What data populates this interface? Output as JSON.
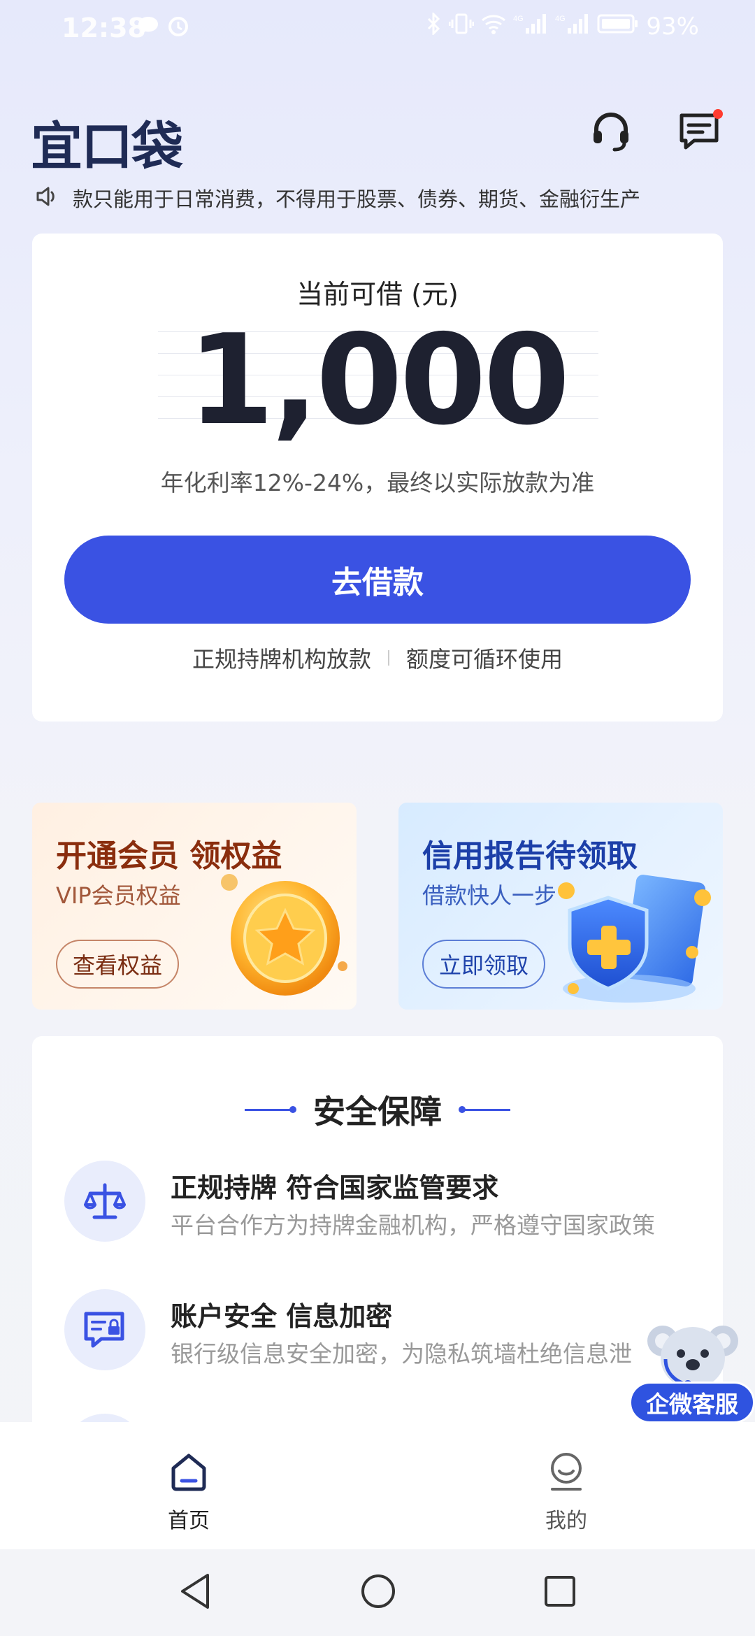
{
  "status_bar": {
    "time": "12:38",
    "battery": "93%",
    "network1": "4G",
    "network2": "4G"
  },
  "header": {
    "logo": "宜口袋",
    "icons": [
      "headset-icon",
      "message-icon"
    ]
  },
  "notice": {
    "icon": "speaker-icon",
    "text": "款只能用于日常消费，不得用于股票、债券、期货、金融衍生产"
  },
  "main_card": {
    "amount_label": "当前可借 (元)",
    "amount": "1,000",
    "rate_text": "年化利率12%-24%，最终以实际放款为准",
    "borrow_button": "去借款",
    "feature_left": "正规持牌机构放款",
    "feature_right": "额度可循环使用"
  },
  "promos": {
    "vip": {
      "title": "开通会员 领权益",
      "subtitle": "VIP会员权益",
      "button": "查看权益"
    },
    "credit": {
      "title": "信用报告待领取",
      "subtitle": "借款快人一步",
      "button": "立即领取"
    }
  },
  "security": {
    "title": "安全保障",
    "items": [
      {
        "title": "正规持牌 符合国家监管要求",
        "desc": "平台合作方为持牌金融机构，严格遵守国家政策",
        "icon": "scale-icon"
      },
      {
        "title": "账户安全 信息加密",
        "desc": "银行级信息安全加密，为隐私筑墙杜绝信息泄",
        "icon": "secure-card-icon"
      }
    ]
  },
  "float_service": {
    "label": "企微客服"
  },
  "tabbar": {
    "items": [
      {
        "label": "首页",
        "icon": "home-icon",
        "active": true
      },
      {
        "label": "我的",
        "icon": "profile-icon",
        "active": false
      }
    ]
  },
  "colors": {
    "primary": "#3a52e3",
    "logo": "#1f2b55",
    "vip_title": "#8a2d0d",
    "credit_title": "#1c3fa8"
  }
}
